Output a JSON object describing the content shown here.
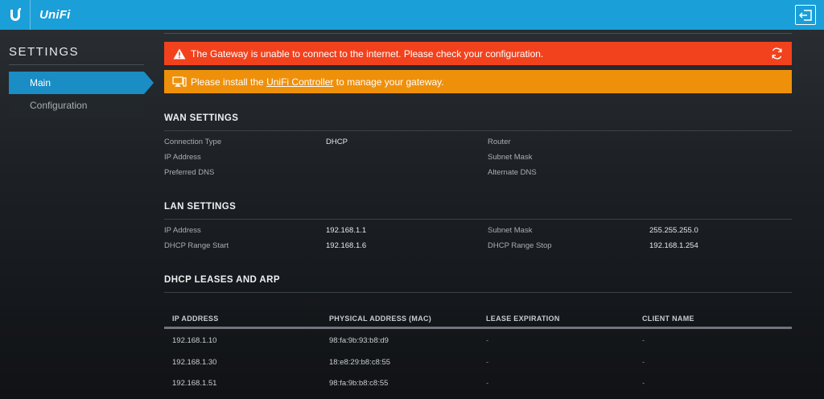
{
  "topbar": {
    "logo_text": "UniFi",
    "logo_icon": "ubiquiti-u-icon",
    "logout_icon": "logout-icon"
  },
  "sidebar": {
    "title": "SETTINGS",
    "items": [
      {
        "label": "Main",
        "active": true
      },
      {
        "label": "Configuration",
        "active": false
      }
    ]
  },
  "alerts": {
    "error": {
      "text": "The Gateway is unable to connect to the internet. Please check your configuration.",
      "icon": "warning-triangle-icon",
      "action_icon": "refresh-icon",
      "color": "#f2421d"
    },
    "warn": {
      "prefix": "Please install the ",
      "link": "UniFi Controller",
      "suffix": " to manage your gateway.",
      "icon": "monitor-icon",
      "color": "#ef900a"
    }
  },
  "wan": {
    "title": "WAN SETTINGS",
    "connection_type_label": "Connection Type",
    "connection_type_value": "DHCP",
    "ip_label": "IP Address",
    "ip_value": "",
    "preferred_dns_label": "Preferred DNS",
    "preferred_dns_value": "",
    "router_label": "Router",
    "router_value": "",
    "subnet_label": "Subnet Mask",
    "subnet_value": "",
    "alternate_dns_label": "Alternate DNS",
    "alternate_dns_value": ""
  },
  "lan": {
    "title": "LAN SETTINGS",
    "ip_label": "IP Address",
    "ip_value": "192.168.1.1",
    "range_start_label": "DHCP Range Start",
    "range_start_value": "192.168.1.6",
    "subnet_label": "Subnet Mask",
    "subnet_value": "255.255.255.0",
    "range_stop_label": "DHCP Range Stop",
    "range_stop_value": "192.168.1.254"
  },
  "leases": {
    "title": "DHCP LEASES AND ARP",
    "columns": [
      "IP ADDRESS",
      "PHYSICAL ADDRESS (MAC)",
      "LEASE EXPIRATION",
      "CLIENT NAME"
    ],
    "rows": [
      {
        "ip": "192.168.1.10",
        "mac": "98:fa:9b:93:b8:d9",
        "expiration": "-",
        "client": "-"
      },
      {
        "ip": "192.168.1.30",
        "mac": "18:e8:29:b8:c8:55",
        "expiration": "-",
        "client": "-"
      },
      {
        "ip": "192.168.1.51",
        "mac": "98:fa:9b:b8:c8:55",
        "expiration": "-",
        "client": "-"
      }
    ]
  },
  "colors": {
    "brand": "#1a9fd8",
    "active_nav": "#1a8dc5"
  }
}
